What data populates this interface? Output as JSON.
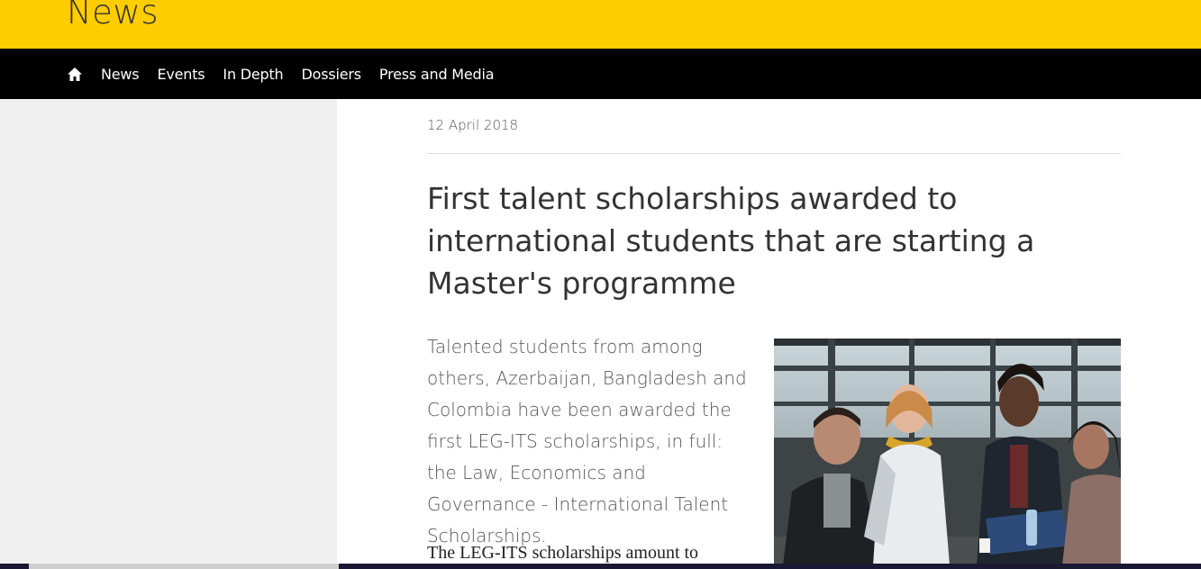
{
  "site": {
    "section_title": "News"
  },
  "nav": {
    "home_icon": "home-icon",
    "items": [
      {
        "label": "News"
      },
      {
        "label": "Events"
      },
      {
        "label": "In Depth"
      },
      {
        "label": "Dossiers"
      },
      {
        "label": "Press and Media"
      }
    ]
  },
  "article": {
    "date": "12 April 2018",
    "title": "First talent scholarships awarded to international students that are starting a Master's programme",
    "lead": "Talented students from among others, Azerbaijan, Bangladesh and Colombia have been awarded the first LEG-ITS scholarships, in full: the Law, Economics and Governance - International Talent Scholarships.",
    "body_start": "The LEG-ITS scholarships amount to"
  },
  "colors": {
    "brand_yellow": "#ffcd00",
    "nav_black": "#000000",
    "sidebar_grey": "#efefef"
  }
}
